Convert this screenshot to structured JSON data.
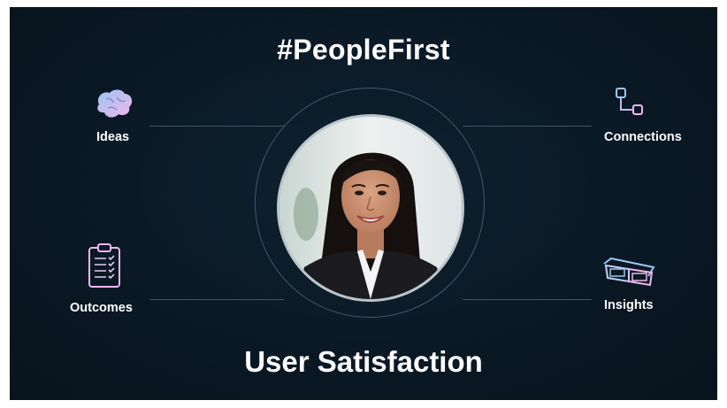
{
  "slide": {
    "title": "#PeopleFirst",
    "subtitle": "User Satisfaction"
  },
  "items": {
    "ideas": {
      "label": "Ideas",
      "icon": "brain-icon"
    },
    "connections": {
      "label": "Connections",
      "icon": "workflow-icon"
    },
    "outcomes": {
      "label": "Outcomes",
      "icon": "clipboard-checklist-icon"
    },
    "insights": {
      "label": "Insights",
      "icon": "3d-glasses-icon"
    }
  },
  "portrait": {
    "subject": "smiling woman in business attire",
    "icon": "portrait-photo"
  },
  "colors": {
    "background": "#0a1824",
    "connector_line": "#3f5563",
    "ring": "#44596a",
    "icon_pink": "#f0b6ee",
    "icon_blue": "#9cc6f2",
    "text": "#ffffff"
  }
}
